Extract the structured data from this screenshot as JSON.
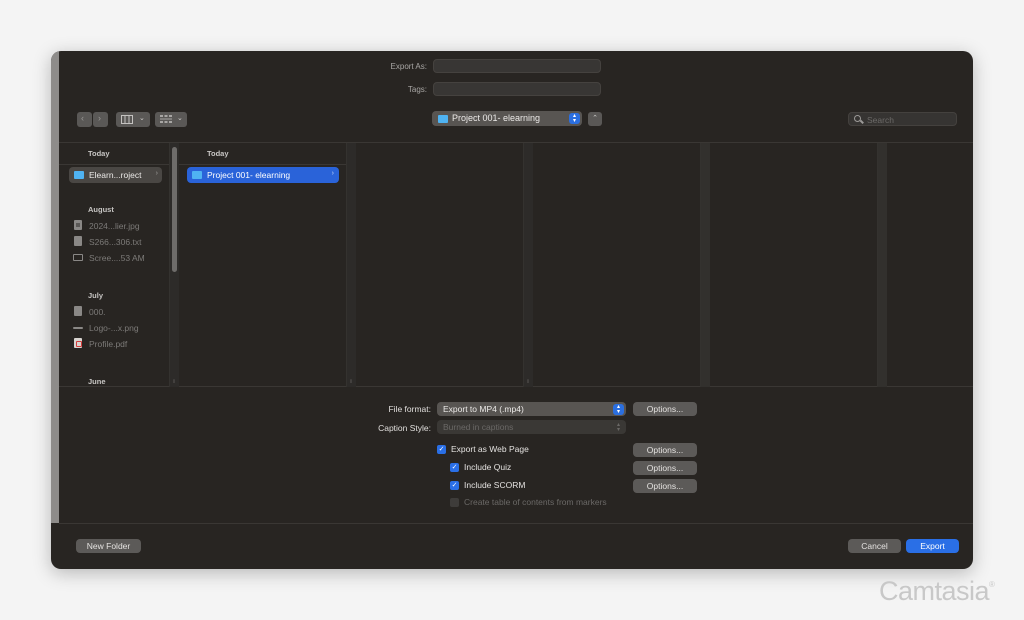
{
  "form": {
    "export_as_label": "Export As:",
    "export_as_value": "",
    "tags_label": "Tags:",
    "tags_value": ""
  },
  "toolbar": {
    "back_icon": "chevron-left-icon",
    "forward_icon": "chevron-right-icon",
    "view_mode_icon": "columns-view-icon",
    "group_icon": "grid-group-icon",
    "location": "Project 001- elearning",
    "up_icon": "chevron-up-icon",
    "search_placeholder": "Search"
  },
  "sidebar": {
    "sections": [
      {
        "header": "Today",
        "items": [
          {
            "label": "Elearn...roject",
            "icon": "folder-icon",
            "selected": true
          }
        ]
      },
      {
        "header": "August",
        "items": [
          {
            "label": "2024...lier.jpg",
            "icon": "image-file-icon"
          },
          {
            "label": "S266...306.txt",
            "icon": "text-file-icon"
          },
          {
            "label": "Scree....53 AM",
            "icon": "screenshot-file-icon"
          }
        ]
      },
      {
        "header": "July",
        "items": [
          {
            "label": "000.",
            "icon": "document-file-icon"
          },
          {
            "label": "Logo-...x.png",
            "icon": "png-file-icon"
          },
          {
            "label": "Profile.pdf",
            "icon": "pdf-file-icon"
          }
        ]
      },
      {
        "header": "June",
        "items": []
      }
    ]
  },
  "column": {
    "header": "Today",
    "items": [
      {
        "label": "Project 001- elearning",
        "icon": "folder-icon",
        "selected": true
      }
    ]
  },
  "options": {
    "file_format_label": "File format:",
    "file_format_value": "Export to MP4 (.mp4)",
    "caption_style_label": "Caption Style:",
    "caption_style_value": "Burned in captions",
    "options_button": "Options...",
    "checkboxes": [
      {
        "label": "Export as Web Page",
        "checked": true,
        "enabled": true
      },
      {
        "label": "Include Quiz",
        "checked": true,
        "enabled": true
      },
      {
        "label": "Include SCORM",
        "checked": true,
        "enabled": true
      },
      {
        "label": "Create table of contents from markers",
        "checked": false,
        "enabled": false
      }
    ]
  },
  "footer": {
    "new_folder": "New Folder",
    "cancel": "Cancel",
    "export": "Export"
  },
  "colors": {
    "accent": "#2a6fe6",
    "selection": "#2a63d9",
    "dialog_bg": "#282522"
  },
  "watermark": {
    "brand": "Camtasia",
    "mark": "®"
  }
}
